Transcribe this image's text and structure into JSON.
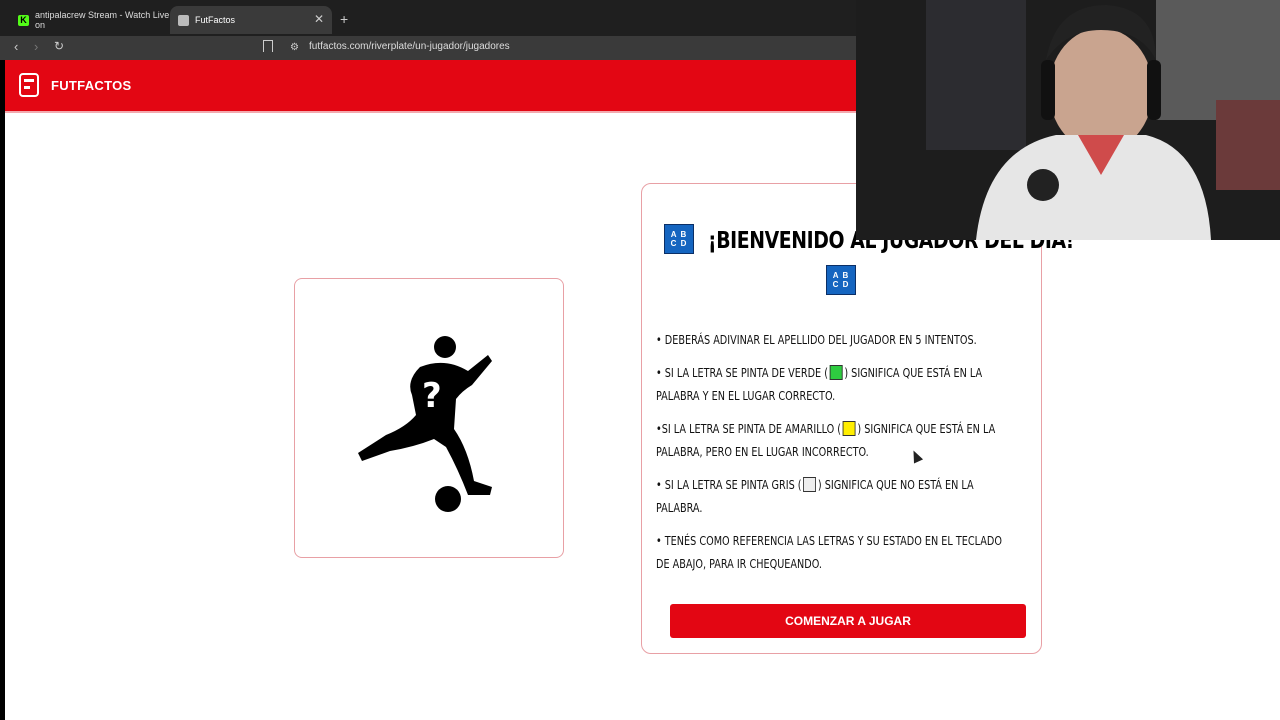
{
  "browser": {
    "tabs": [
      {
        "title": "antipalacrew Stream - Watch Live on",
        "active": false
      },
      {
        "title": "FutFactos",
        "active": true
      }
    ],
    "url": "futfactos.com/riverplate/un-jugador/jugadores"
  },
  "header": {
    "logo_text": "FUTFACTOS",
    "brand_color": "#e30613"
  },
  "player_card": {
    "image": "player-silhouette-question-icon"
  },
  "rules_card": {
    "badge_text": "A B C D",
    "title": "¡BIENVENIDO AL JUGADOR DEL DÍA!",
    "rules": [
      {
        "before": "• DEBERÁS ADIVINAR EL APELLIDO DEL JUGADOR EN 5 INTENTOS.",
        "after": ""
      },
      {
        "before": "• SI LA LETRA SE PINTA DE VERDE (",
        "swatch": "#2ecc40",
        "after": ") SIGNIFICA QUE ESTÁ EN LA PALABRA Y EN EL LUGAR CORRECTO."
      },
      {
        "before": "•SI LA LETRA SE PINTA DE AMARILLO (",
        "swatch": "#ffee00",
        "after": ") SIGNIFICA QUE ESTÁ EN LA PALABRA, PERO EN EL LUGAR INCORRECTO."
      },
      {
        "before": "• SI LA LETRA SE PINTA GRIS (",
        "swatch": "#eeeeee",
        "after": ") SIGNIFICA QUE NO ESTÁ EN LA PALABRA."
      },
      {
        "before": "• TENÉS COMO REFERENCIA LAS LETRAS Y SU ESTADO EN EL TECLADO DE ABAJO, PARA IR CHEQUEANDO.",
        "after": ""
      }
    ],
    "start_button": "COMENZAR A JUGAR"
  }
}
